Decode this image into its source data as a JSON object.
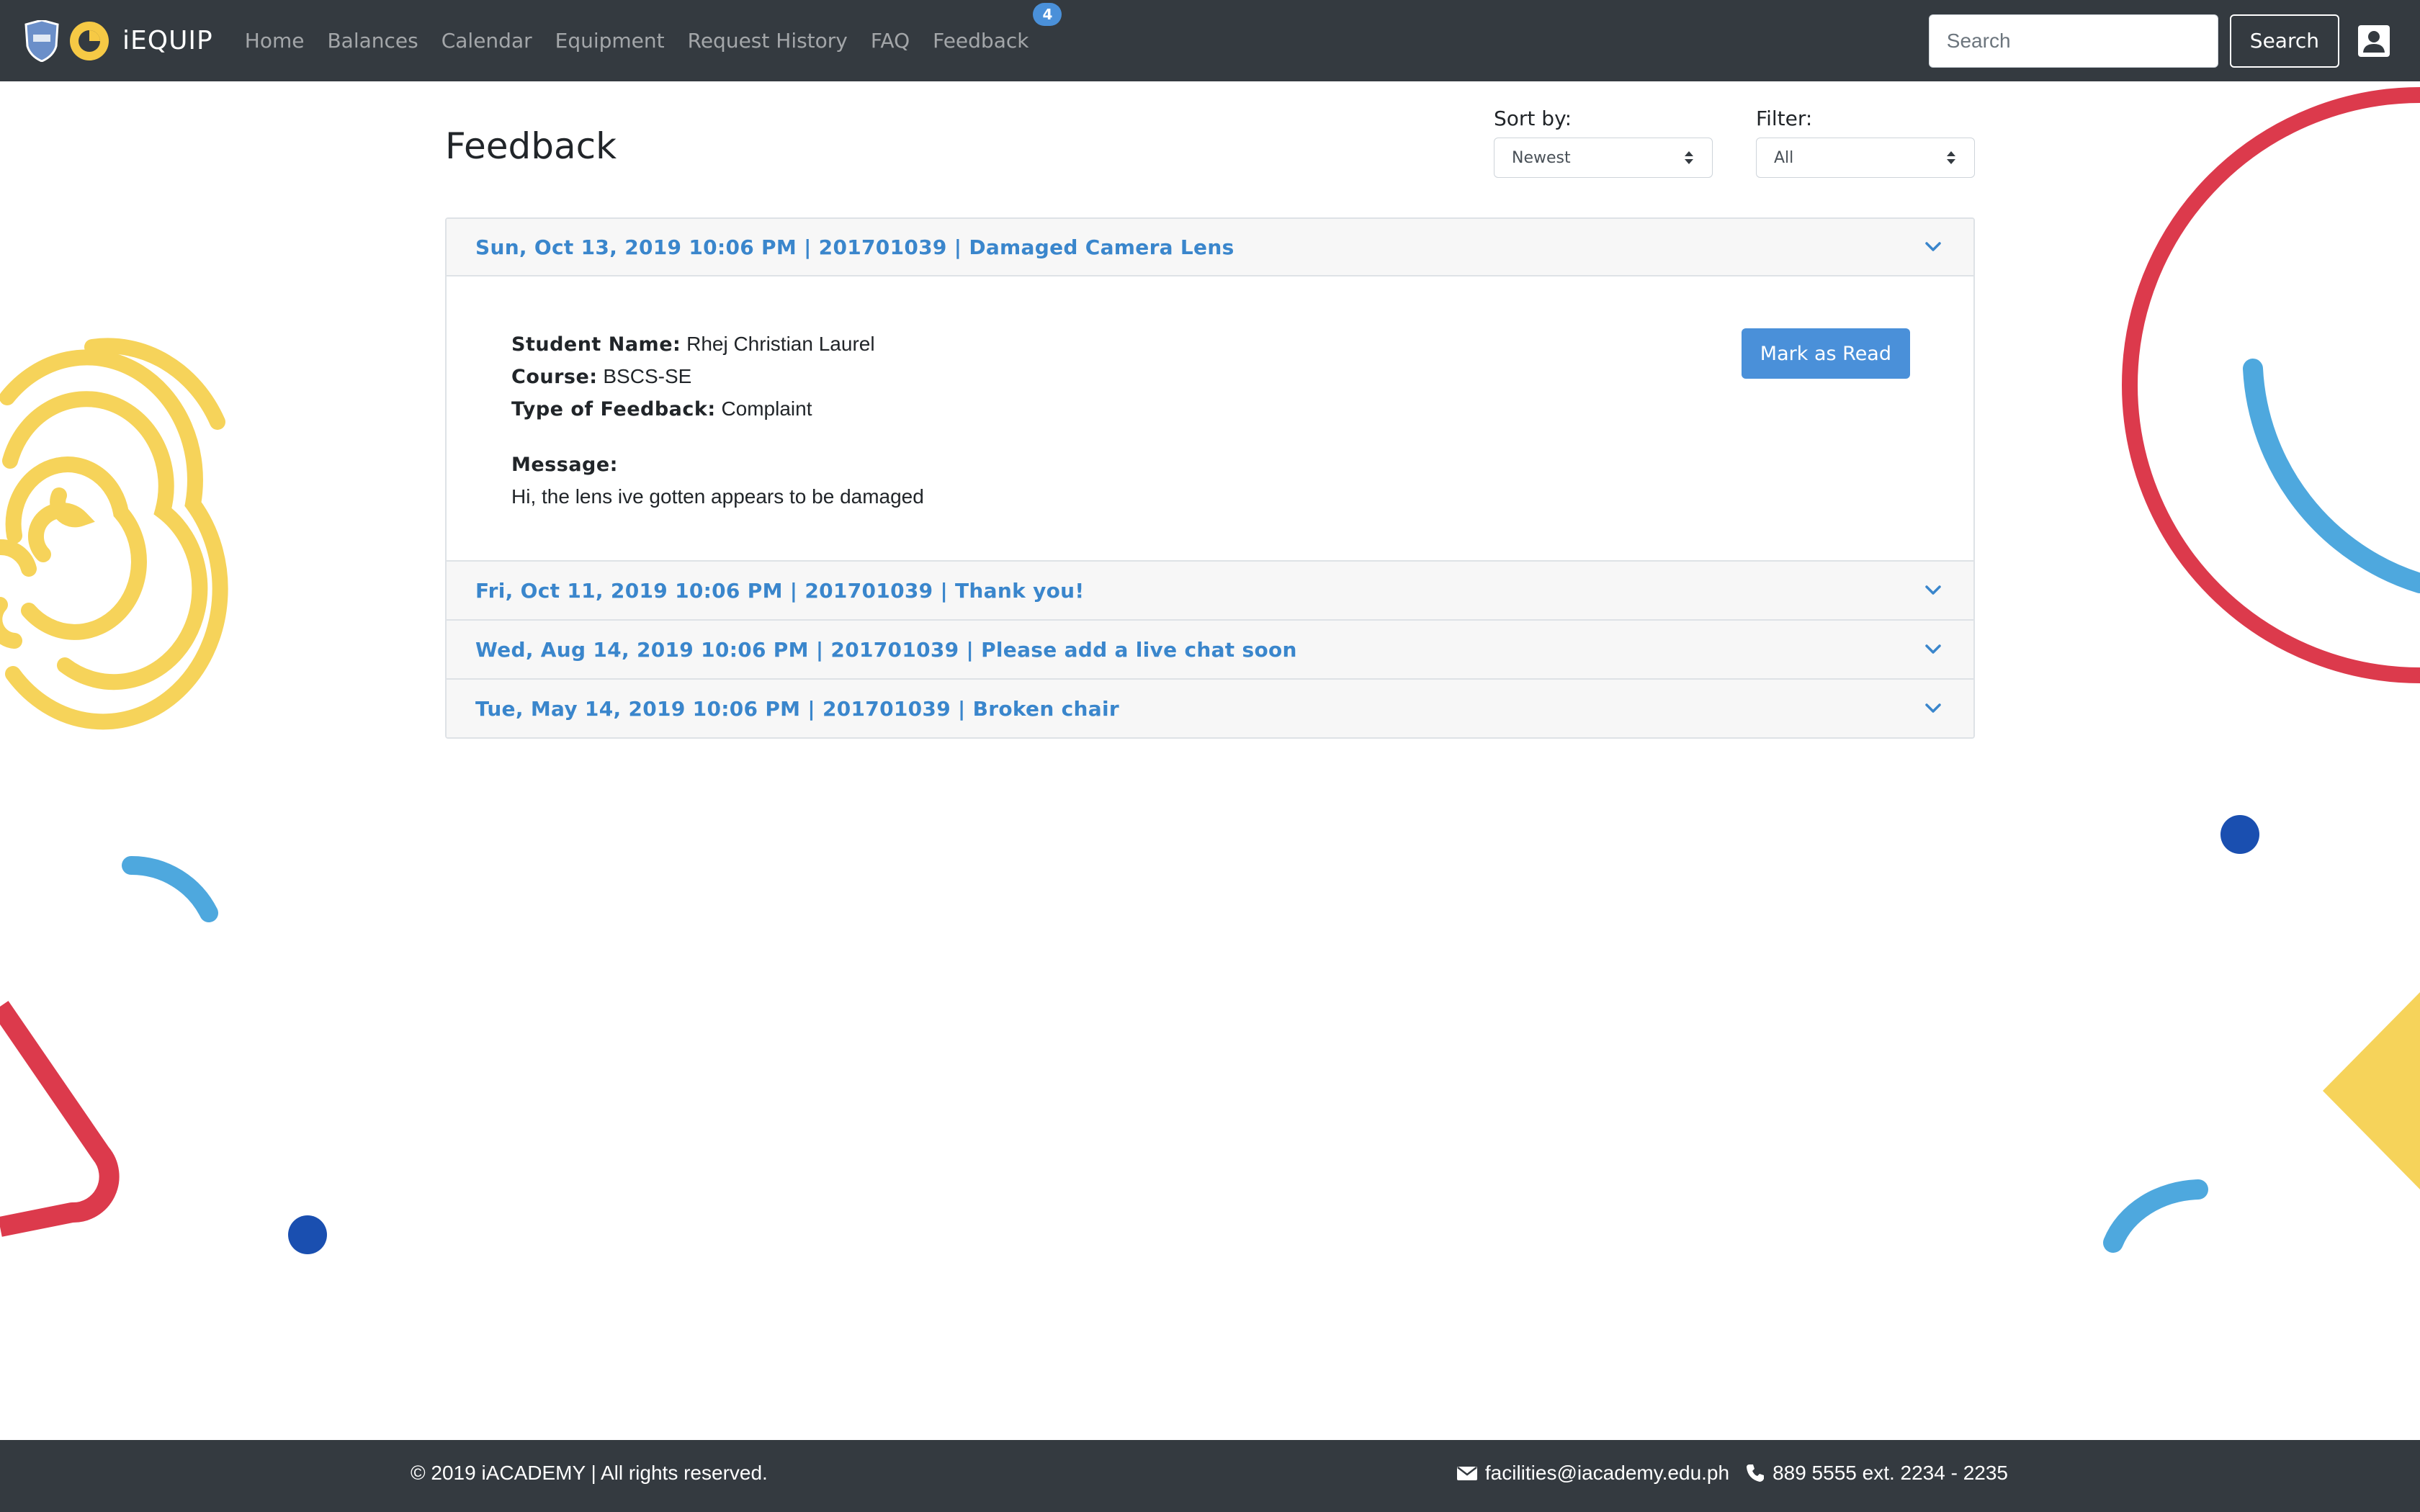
{
  "brand": {
    "name": "iEQUIP"
  },
  "nav": {
    "items": [
      {
        "label": "Home"
      },
      {
        "label": "Balances"
      },
      {
        "label": "Calendar"
      },
      {
        "label": "Equipment"
      },
      {
        "label": "Request History"
      },
      {
        "label": "FAQ"
      },
      {
        "label": "Feedback",
        "badge": "4"
      }
    ],
    "search_placeholder": "Search",
    "search_button": "Search",
    "user_icon": "user-icon"
  },
  "page": {
    "title": "Feedback",
    "sort": {
      "label": "Sort by:",
      "value": "Newest"
    },
    "filter": {
      "label": "Filter:",
      "value": "All"
    }
  },
  "feedback": [
    {
      "header": "Sun, Oct 13, 2019 10:06 PM | 201701039 | Damaged Camera Lens",
      "expanded": true,
      "student_name_label": "Student Name:",
      "student_name": "Rhej Christian Laurel",
      "course_label": "Course:",
      "course": "BSCS-SE",
      "type_label": "Type of Feedback:",
      "type": "Complaint",
      "message_label": "Message:",
      "message": "Hi, the lens ive gotten appears to be damaged",
      "action": "Mark as Read"
    },
    {
      "header": "Fri, Oct 11, 2019 10:06 PM | 201701039 | Thank you!",
      "expanded": false
    },
    {
      "header": "Wed, Aug 14, 2019 10:06 PM | 201701039 | Please add a live chat soon",
      "expanded": false
    },
    {
      "header": "Tue, May 14, 2019 10:06 PM | 201701039 | Broken chair",
      "expanded": false
    }
  ],
  "footer": {
    "copyright": "© 2019 iACADEMY | All rights reserved.",
    "email": "facilities@iacademy.edu.ph",
    "phone": "889 5555 ext. 2234 - 2235"
  },
  "colors": {
    "navbar": "#343a40",
    "accent": "#4a90d9",
    "link": "#3a86cc",
    "deco_red": "#dc3a4c",
    "deco_yellow": "#f6d35a",
    "deco_light_blue": "#4ea8de",
    "deco_dark_blue": "#1a4fb0"
  }
}
